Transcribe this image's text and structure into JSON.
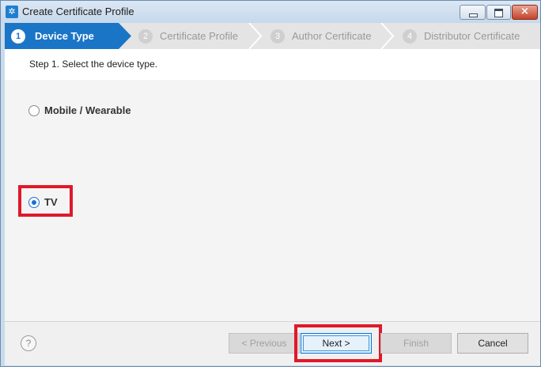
{
  "window": {
    "title": "Create Certificate Profile"
  },
  "steps": [
    {
      "number": "1",
      "label": "Device Type",
      "active": true
    },
    {
      "number": "2",
      "label": "Certificate Profile",
      "active": false
    },
    {
      "number": "3",
      "label": "Author Certificate",
      "active": false
    },
    {
      "number": "4",
      "label": "Distributor Certificate",
      "active": false
    }
  ],
  "main": {
    "instruction": "Step 1. Select the device type.",
    "options": [
      {
        "label": "Mobile / Wearable",
        "selected": false
      },
      {
        "label": "TV",
        "selected": true
      }
    ]
  },
  "footer": {
    "help_glyph": "?",
    "previous_label": "< Previous",
    "next_label": "Next >",
    "finish_label": "Finish",
    "cancel_label": "Cancel"
  },
  "colors": {
    "active_step": "#1b75c6",
    "highlight": "#e0182b",
    "radio_selected": "#1c6fd6"
  }
}
